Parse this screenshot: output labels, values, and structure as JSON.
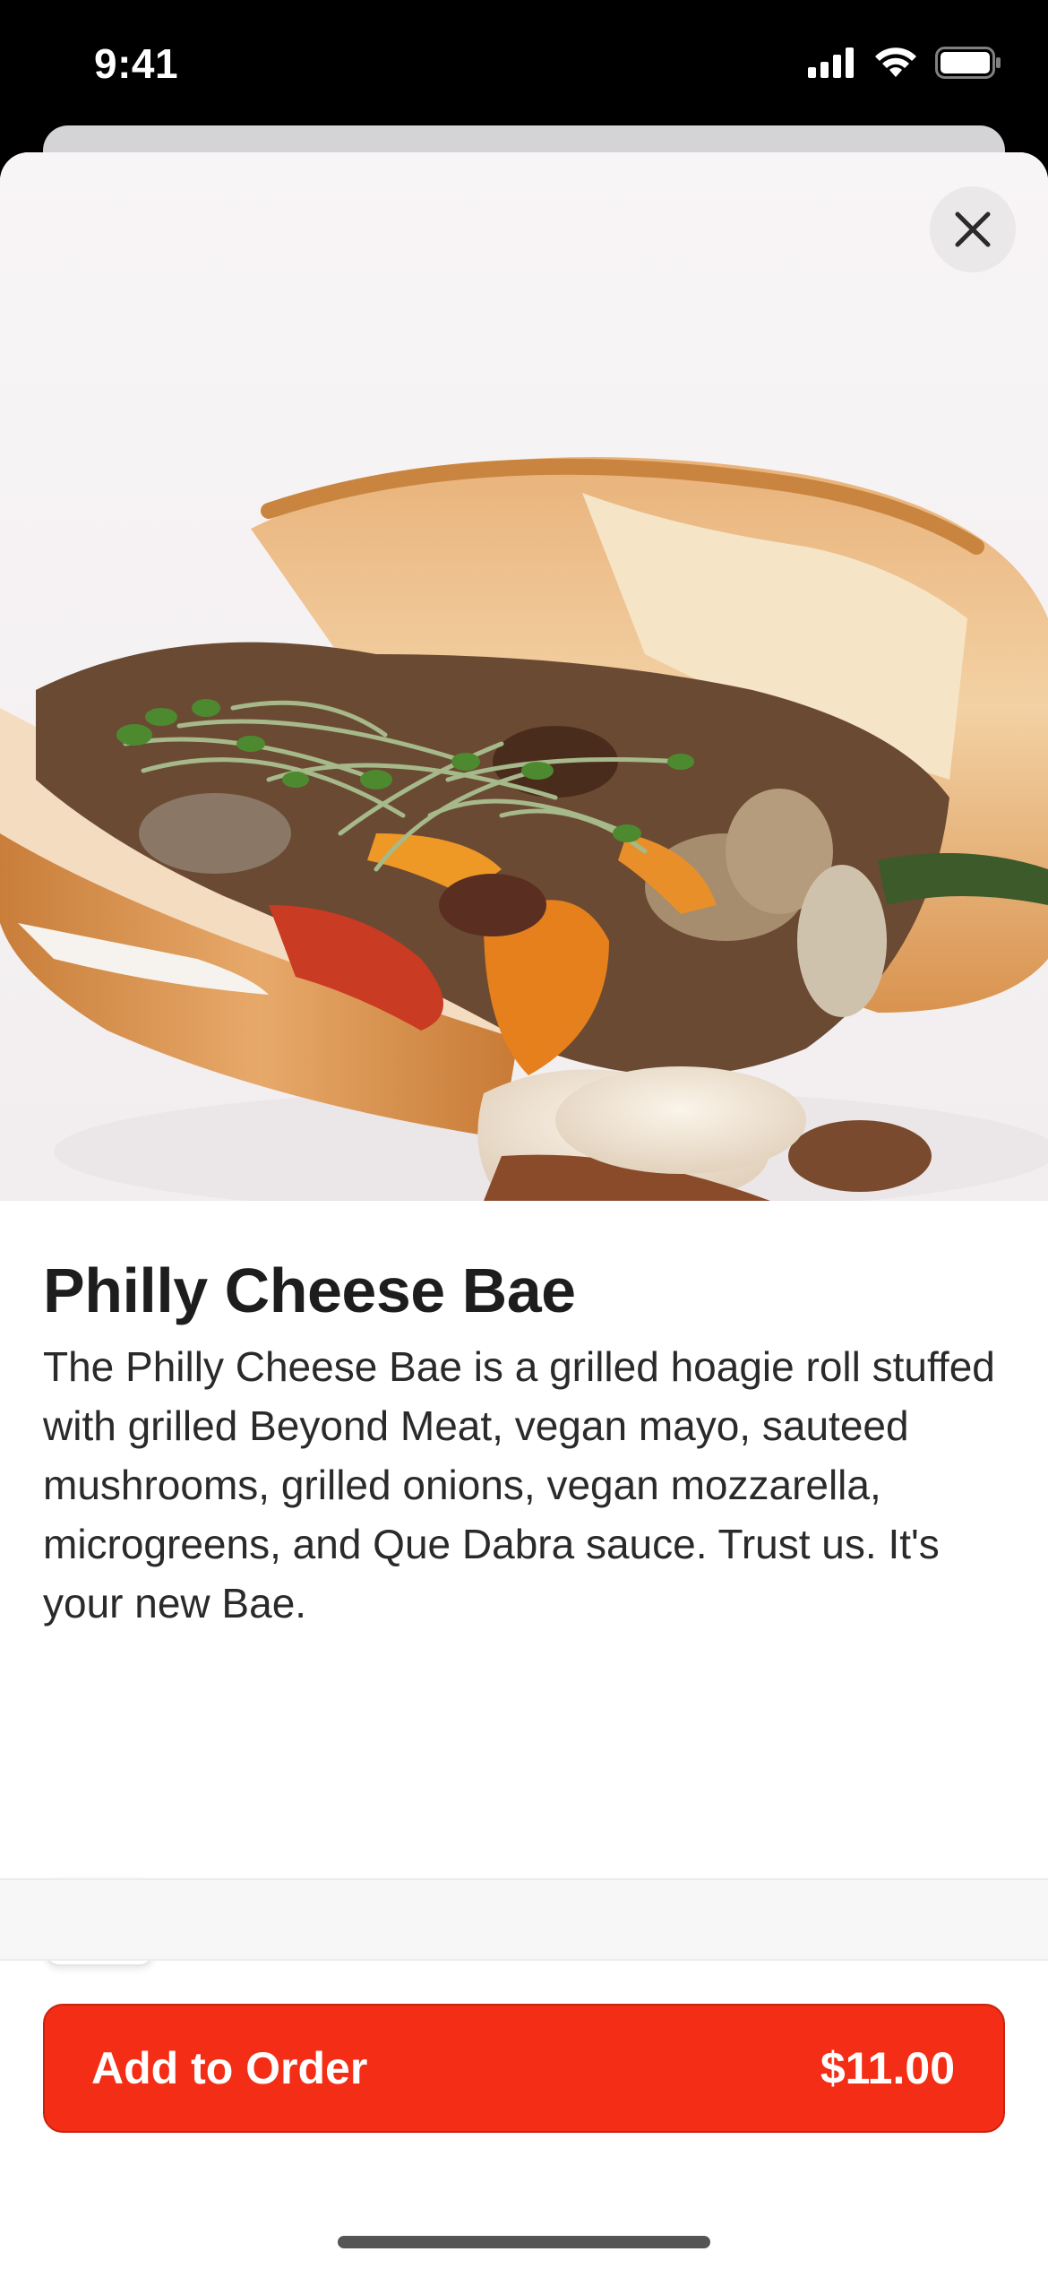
{
  "status_bar": {
    "time": "9:41",
    "icons": [
      "signal-icon",
      "wifi-icon",
      "battery-icon"
    ]
  },
  "hero": {
    "image_description_icon": "sandwich-photo",
    "close_icon": "close-icon"
  },
  "item": {
    "title": "Philly Cheese Bae",
    "description": "The Philly Cheese Bae is a grilled hoagie roll stuffed with grilled Beyond Meat, vegan mayo, sauteed mushrooms, grilled onions, vegan mozzarella, microgreens, and Que Dabra sauce. Trust us. It's your new Bae.",
    "favorite_icon": "heart-icon"
  },
  "footer": {
    "add_label": "Add to Order",
    "price": "$11.00"
  },
  "colors": {
    "accent": "#f42e16",
    "background": "#ffffff",
    "text": "#1d1d1d"
  }
}
